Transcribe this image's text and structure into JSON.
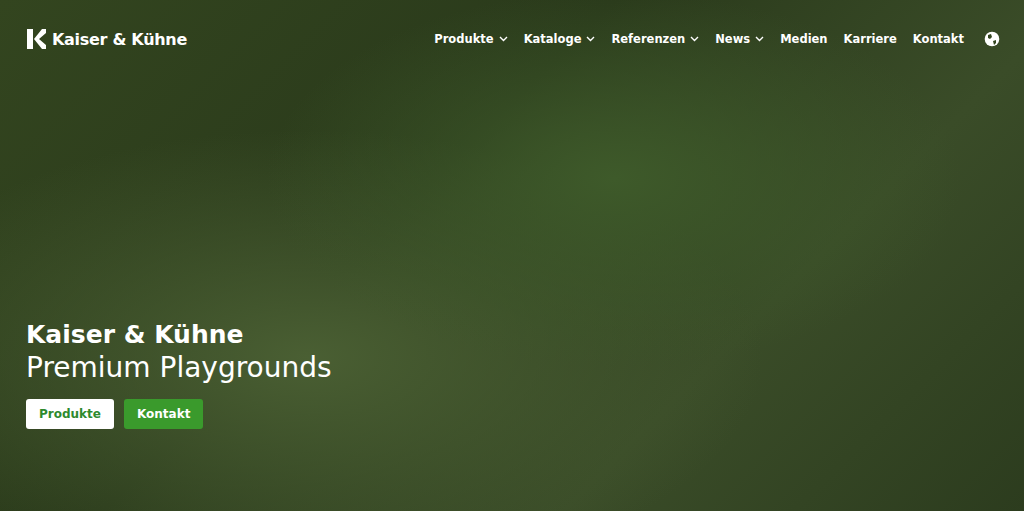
{
  "header": {
    "logo": "Kaiser & Kühne",
    "nav": [
      {
        "label": "Produkte",
        "kind": "dropdown"
      },
      {
        "label": "Kataloge",
        "kind": "dropdown"
      },
      {
        "label": "Referenzen",
        "kind": "dropdown"
      },
      {
        "label": "News",
        "kind": "dropdown"
      },
      {
        "label": "Medien",
        "kind": "link"
      },
      {
        "label": "Karriere",
        "kind": "link"
      },
      {
        "label": "Kontakt",
        "kind": "link"
      }
    ]
  },
  "hero": {
    "title": "Kaiser & Kühne",
    "subtitle": "Premium Playgrounds",
    "buttons": [
      {
        "label": "Produkte",
        "kind": "light"
      },
      {
        "label": "Kontakt",
        "kind": "green"
      }
    ]
  }
}
